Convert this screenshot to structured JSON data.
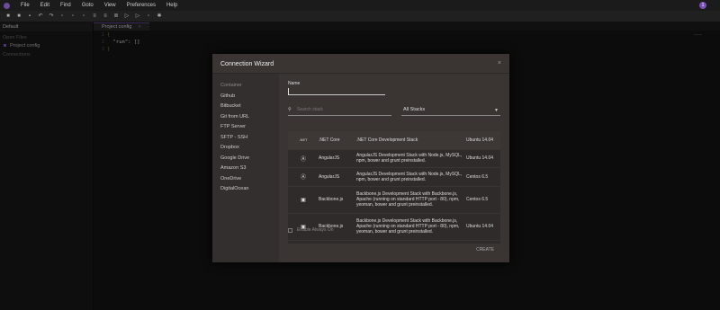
{
  "menu": {
    "items": [
      "File",
      "Edit",
      "Find",
      "Goto",
      "View",
      "Preferences",
      "Help"
    ],
    "avatar": "1"
  },
  "sidebar": {
    "project": "Default",
    "open_files_label": "Open Files",
    "open_file": "Project config",
    "connections_label": "Connections"
  },
  "editor": {
    "tab": "Project config",
    "tab_close": "×",
    "lines": [
      {
        "n": "1",
        "t": "{"
      },
      {
        "n": "2",
        "t": "  \"run\": []"
      },
      {
        "n": "3",
        "t": "}"
      }
    ]
  },
  "modal": {
    "title": "Connection Wizard",
    "close": "×",
    "nav": [
      "Container",
      "Github",
      "Bitbucket",
      "Git from URL",
      "FTP Server",
      "SFTP - SSH",
      "Dropbox",
      "Google Drive",
      "Amazon S3",
      "OneDrive",
      "DigitalOcean"
    ],
    "name_label": "Name",
    "search_placeholder": "Search stack",
    "stack_filter": "All Stacks",
    "stacks": [
      {
        "icon": ".NET",
        "name": ".NET Core",
        "desc": ".NET Core Development Stack",
        "os": "Ubuntu 14.04"
      },
      {
        "icon": "Ⓐ",
        "name": "AngularJS",
        "desc": "AngularJS Development Stack with Node.js, MySQL, npm, bower and grunt preinstalled.",
        "os": "Ubuntu 14.04"
      },
      {
        "icon": "Ⓐ",
        "name": "AngularJS",
        "desc": "AngularJS Development Stack with Node.js, MySQL, npm, bower and grunt preinstalled.",
        "os": "Centos 6.5"
      },
      {
        "icon": "▣",
        "name": "Backbone.js",
        "desc": "Backbone.js Development Stack with Backbone.js, Apache (running on standard HTTP port - 80), npm, yeoman, bower and grunt preinstalled.",
        "os": "Centos 6.5"
      },
      {
        "icon": "▣",
        "name": "Backbone.js",
        "desc": "Backbone.js Development Stack with Backbone.js, Apache (running on standard HTTP port - 80), npm, yeoman, bower and grunt preinstalled.",
        "os": "Ubuntu 14.04"
      }
    ],
    "enable_always_on": "Enable Always On",
    "create": "CREATE"
  }
}
